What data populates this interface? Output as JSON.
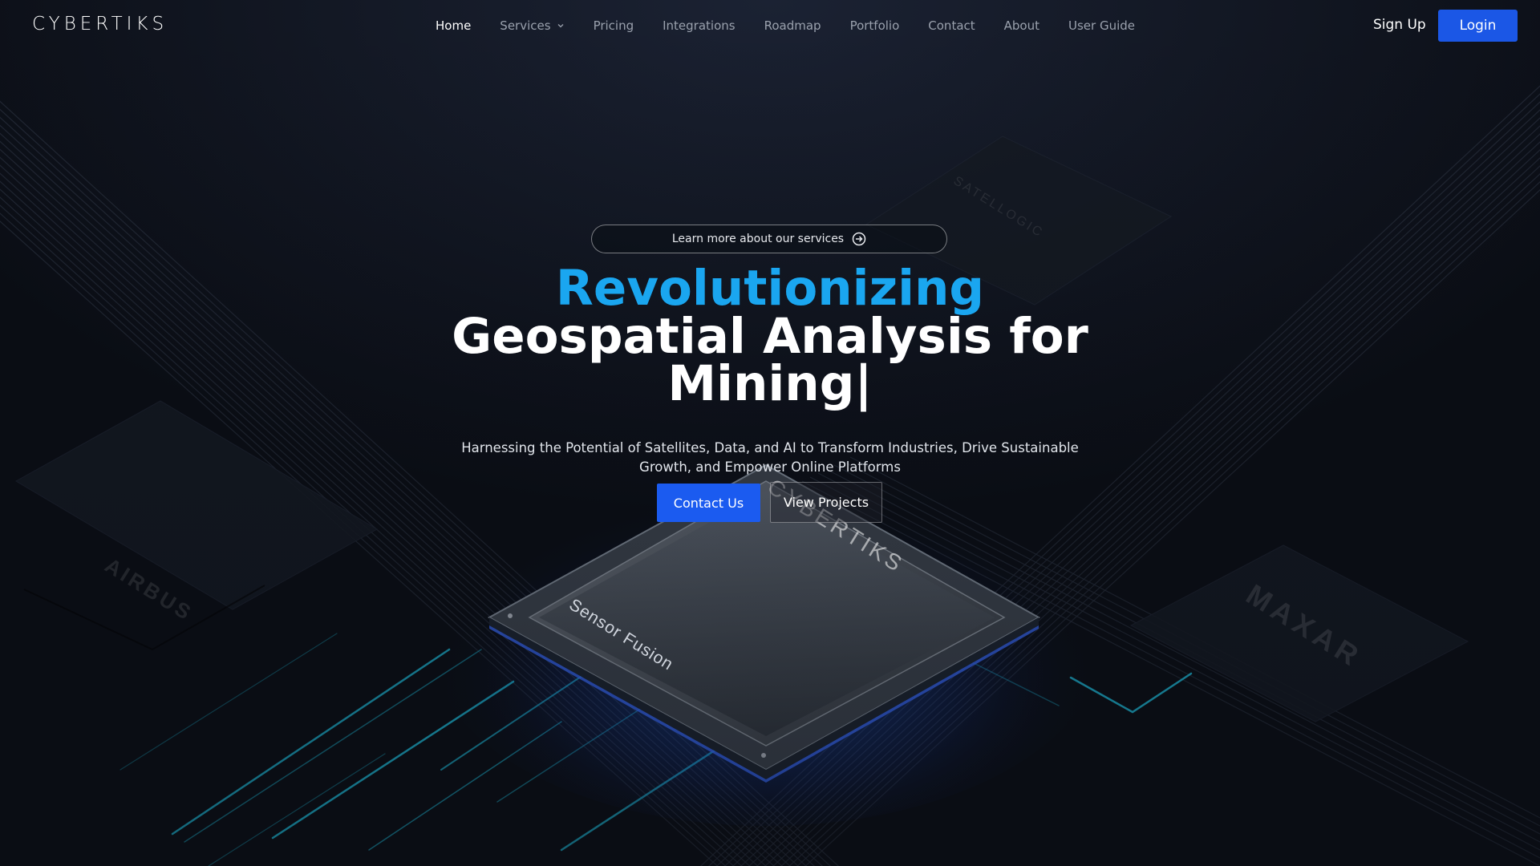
{
  "brand": {
    "logo_text": "CYBERTIKS"
  },
  "nav": {
    "items": [
      {
        "label": "Home",
        "active": true
      },
      {
        "label": "Services",
        "has_dropdown": true
      },
      {
        "label": "Pricing"
      },
      {
        "label": "Integrations"
      },
      {
        "label": "Roadmap"
      },
      {
        "label": "Portfolio"
      },
      {
        "label": "Contact"
      },
      {
        "label": "About"
      },
      {
        "label": "User Guide"
      }
    ],
    "signup_label": "Sign Up",
    "login_label": "Login"
  },
  "hero": {
    "pill_label": "Learn more about our services",
    "pill_icon": "arrow-circle-right-icon",
    "headline_accent": "Revolutionizing",
    "headline_line2": "Geospatial Analysis for",
    "headline_line3": "Mining|",
    "subtitle": "Harnessing the Potential of Satellites, Data, and AI to Transform Industries, Drive Sustainable Growth, and Empower Online Platforms",
    "contact_button": "Contact Us",
    "projects_button": "View Projects"
  },
  "background": {
    "chip_label": "Sensor Fusion",
    "chip_brand_text": "CYBERTIKS",
    "partner_marks": [
      "AIRBUS",
      "MAXAR",
      "SATELLOGIC"
    ]
  },
  "colors": {
    "background": "#0a0d14",
    "accent_blue": "#1aa6f0",
    "button_blue": "#1b5bf0",
    "login_blue": "#1b57e6",
    "nav_text": "#9aa1ad",
    "glow_cyan": "#1ec8e8"
  }
}
